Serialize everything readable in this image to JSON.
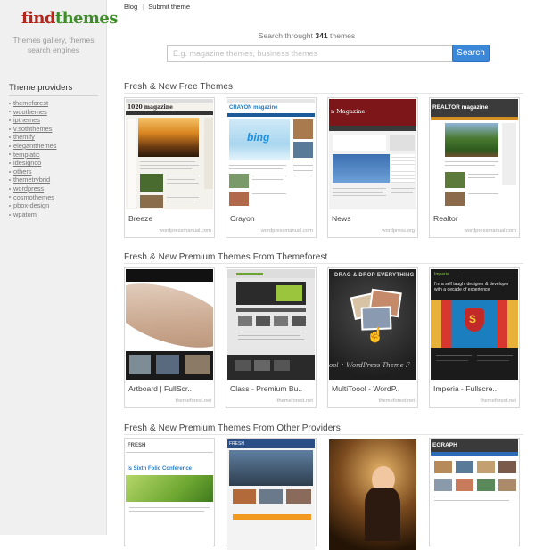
{
  "logo": {
    "part1": "find",
    "part2": "themes"
  },
  "tagline": "Themes gallery, themes search engines",
  "sidebar": {
    "title": "Theme providers",
    "providers": [
      "themeforest",
      "woothemes",
      "ipthemes",
      "v.soththemes",
      "themify",
      "elegantthemes",
      "templatic",
      "idesignco",
      "others",
      "themetrybrid",
      "wordpress",
      "cosmothemes",
      "pbox-design",
      "wpatom"
    ]
  },
  "nav": {
    "blog": "Blog",
    "submit": "Submit theme"
  },
  "search": {
    "label_prefix": "Search throught",
    "count": "341",
    "label_suffix": "themes",
    "placeholder": "E.g. magazine themes, business themes",
    "button": "Search"
  },
  "sections": [
    {
      "title": "Fresh & New Free Themes",
      "cards": [
        {
          "name": "Breeze",
          "source": "wordpressmanual.com",
          "header": "1020 magazine"
        },
        {
          "name": "Crayon",
          "source": "wordpressmanual.com",
          "header": "CRAYON magazine"
        },
        {
          "name": "News",
          "source": "wordpress.org",
          "header": "n Magazine"
        },
        {
          "name": "Realtor",
          "source": "wordpressmanual.com",
          "header": "REALTOR magazine"
        }
      ]
    },
    {
      "title": "Fresh & New Premium Themes From Themeforest",
      "cards": [
        {
          "name": "Artboard | FullScr..",
          "source": "themeforest.net"
        },
        {
          "name": "Class - Premium Bu..",
          "source": "themeforest.net"
        },
        {
          "name": "MultiToool - WordP..",
          "source": "themeforest.net",
          "banner": "DRAG & DROP EVERYTHING",
          "caption": "ool • WordPress Theme F"
        },
        {
          "name": "Imperia - Fullscre..",
          "source": "themeforest.net",
          "tagline": "I'm a self taught designer & developer with a decade of experience"
        }
      ]
    },
    {
      "title": "Fresh & New Premium Themes From Other Providers",
      "cards": [
        {
          "name": "",
          "source": "",
          "header": "FRESH",
          "headline": "Is Sixth Folio Conference"
        },
        {
          "name": "",
          "source": "",
          "header": "FRESH"
        },
        {
          "name": "",
          "source": ""
        },
        {
          "name": "",
          "source": "",
          "header": "EGRAPH"
        }
      ]
    }
  ],
  "colors": {
    "logo_red": "#b2261c",
    "logo_green": "#3f8d2a",
    "search_button": "#3b88d8",
    "sidebar_bg": "#f0f0f0"
  }
}
